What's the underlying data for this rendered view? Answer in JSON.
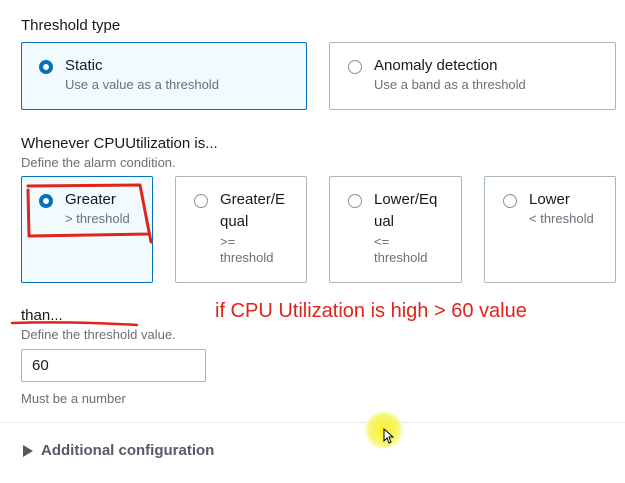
{
  "threshold_type": {
    "heading": "Threshold type",
    "options": [
      {
        "title": "Static",
        "desc": "Use a value as a threshold",
        "selected": true
      },
      {
        "title": "Anomaly detection",
        "desc": "Use a band as a threshold",
        "selected": false
      }
    ]
  },
  "condition": {
    "heading": "Whenever CPUUtilization is...",
    "desc": "Define the alarm condition.",
    "options": [
      {
        "title": "Greater",
        "desc": "> threshold",
        "selected": true
      },
      {
        "title_l1": "Greater/E",
        "title_l2": "qual",
        "desc_l1": ">=",
        "desc_l2": "threshold",
        "selected": false
      },
      {
        "title_l1": "Lower/Eq",
        "title_l2": "ual",
        "desc_l1": "<=",
        "desc_l2": "threshold",
        "selected": false
      },
      {
        "title": "Lower",
        "desc": "< threshold",
        "selected": false
      }
    ]
  },
  "than": {
    "heading": "than...",
    "desc": "Define the threshold value.",
    "value": "60",
    "hint": "Must be a number"
  },
  "annotation": {
    "text": "if CPU Utilization is high > 60 value",
    "color": "#e0241b"
  },
  "additional": {
    "label": "Additional configuration"
  },
  "colors": {
    "accent": "#0073bb",
    "annotation_red": "#e0241b",
    "cursor_highlight": "#f4f000"
  }
}
